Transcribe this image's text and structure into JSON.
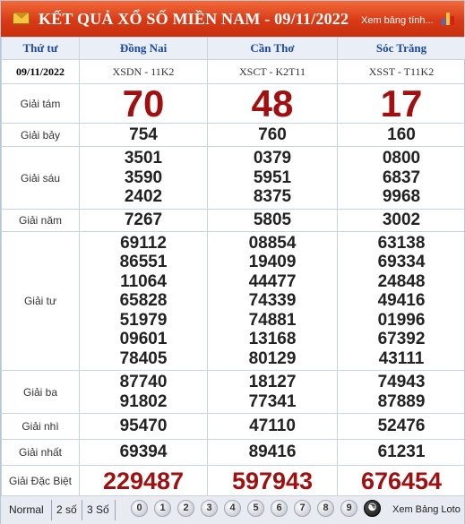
{
  "header": {
    "title": "KẾT QUẢ XỔ SỐ MIỀN NAM - 09/11/2022",
    "link": "Xem bảng tính...",
    "icon_mail": "mail-icon",
    "icon_chart": "bar-chart-icon"
  },
  "table": {
    "weekday": "Thứ tư",
    "date": "09/11/2022",
    "provinces": [
      {
        "name": "Đồng Nai",
        "code": "XSDN - 11K2"
      },
      {
        "name": "Cần Thơ",
        "code": "XSCT - K2T11"
      },
      {
        "name": "Sóc Trăng",
        "code": "XSST - T11K2"
      }
    ],
    "prizes": [
      {
        "label": "Giải tám",
        "values": [
          [
            "70"
          ],
          [
            "48"
          ],
          [
            "17"
          ]
        ]
      },
      {
        "label": "Giải bảy",
        "values": [
          [
            "754"
          ],
          [
            "760"
          ],
          [
            "160"
          ]
        ]
      },
      {
        "label": "Giải sáu",
        "values": [
          [
            "3501",
            "3590",
            "2402"
          ],
          [
            "0379",
            "5951",
            "8375"
          ],
          [
            "0800",
            "6837",
            "9968"
          ]
        ]
      },
      {
        "label": "Giải năm",
        "values": [
          [
            "7267"
          ],
          [
            "5805"
          ],
          [
            "3002"
          ]
        ]
      },
      {
        "label": "Giải tư",
        "values": [
          [
            "69112",
            "86551",
            "11064",
            "65828",
            "51979",
            "09601",
            "78405"
          ],
          [
            "08854",
            "19409",
            "44477",
            "74339",
            "74881",
            "13168",
            "80129"
          ],
          [
            "63138",
            "69334",
            "24848",
            "49416",
            "01996",
            "67392",
            "43111"
          ]
        ]
      },
      {
        "label": "Giải ba",
        "values": [
          [
            "87740",
            "91802"
          ],
          [
            "18127",
            "77341"
          ],
          [
            "74943",
            "87889"
          ]
        ]
      },
      {
        "label": "Giải nhì",
        "values": [
          [
            "95470"
          ],
          [
            "47110"
          ],
          [
            "52476"
          ]
        ]
      },
      {
        "label": "Giải nhất",
        "values": [
          [
            "69394"
          ],
          [
            "89416"
          ],
          [
            "61231"
          ]
        ]
      },
      {
        "label": "Giải Đặc Biệt",
        "values": [
          [
            "229487"
          ],
          [
            "597943"
          ],
          [
            "676454"
          ]
        ]
      }
    ]
  },
  "footer": {
    "options": [
      "Normal",
      "2 số",
      "3 Số"
    ],
    "digits": [
      "0",
      "1",
      "2",
      "3",
      "4",
      "5",
      "6",
      "7",
      "8",
      "9"
    ],
    "reset_icon": "yin-yang-icon",
    "more": "Xem Bảng Loto"
  },
  "colors": {
    "header_bg": "#d83a16",
    "prize_red": "#a01010",
    "province_blue": "#1d4aa0"
  }
}
